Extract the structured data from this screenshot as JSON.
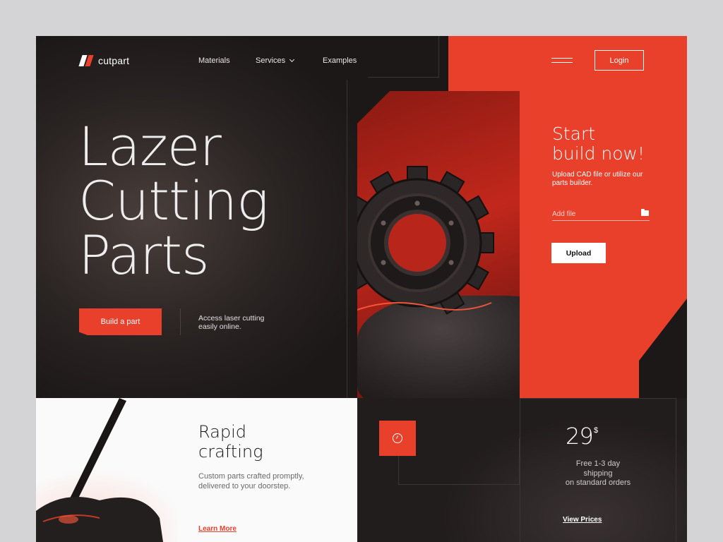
{
  "brand": {
    "name": "cutpart",
    "accent": "#e8402b"
  },
  "nav": {
    "items": [
      {
        "label": "Materials"
      },
      {
        "label": "Services",
        "has_dropdown": true
      },
      {
        "label": "Examples"
      }
    ],
    "login_label": "Login"
  },
  "hero": {
    "title_lines": [
      "Lazer",
      "Cutting",
      "Parts"
    ],
    "cta_label": "Build a part",
    "note": "Access laser cutting easily online."
  },
  "start_card": {
    "title_line1": "Start",
    "title_line2": "build now!",
    "subtitle": "Upload CAD file or utilize our parts builder.",
    "file_placeholder": "Add file",
    "upload_label": "Upload"
  },
  "rapid": {
    "title_line1": "Rapid",
    "title_line2": "crafting",
    "subtitle": "Custom parts crafted promptly, delivered to your doorstep.",
    "link_label": "Learn More"
  },
  "pricing": {
    "price": "29",
    "currency": "$",
    "shipping_line1": "Free 1-3 day",
    "shipping_line2": "shipping",
    "shipping_line3": "on standard orders",
    "link_label": "View Prices"
  }
}
